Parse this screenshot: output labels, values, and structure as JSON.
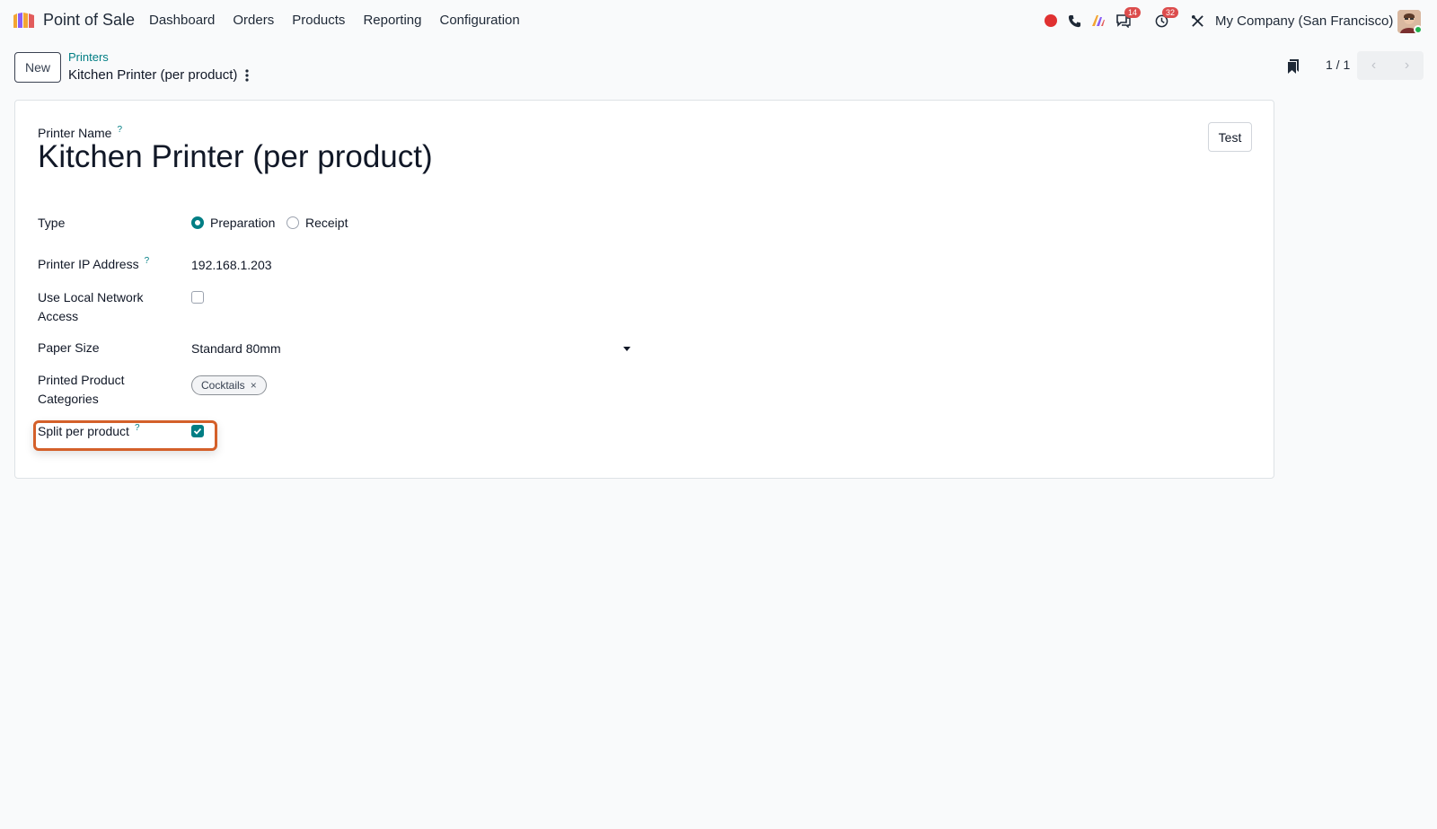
{
  "navbar": {
    "app_title": "Point of Sale",
    "menu": [
      "Dashboard",
      "Orders",
      "Products",
      "Reporting",
      "Configuration"
    ],
    "messages_badge": "14",
    "activities_badge": "32",
    "company": "My Company (San Francisco)"
  },
  "control_panel": {
    "new_label": "New",
    "breadcrumb_parent": "Printers",
    "breadcrumb_current": "Kitchen Printer (per product)",
    "pager": "1 / 1"
  },
  "form": {
    "name_label": "Printer Name",
    "help_mark": "?",
    "name_value": "Kitchen Printer (per product)",
    "test_label": "Test",
    "type_label": "Type",
    "type_options": [
      "Preparation",
      "Receipt"
    ],
    "type_selected": "Preparation",
    "ip_label": "Printer IP Address",
    "ip_value": "192.168.1.203",
    "local_network_label_1": "Use Local Network",
    "local_network_label_2": "Access",
    "local_network_checked": false,
    "paper_size_label": "Paper Size",
    "paper_size_value": "Standard 80mm",
    "categories_label_1": "Printed Product",
    "categories_label_2": "Categories",
    "category_tags": [
      "Cocktails"
    ],
    "tag_remove": "×",
    "split_label": "Split per product",
    "split_checked": true
  },
  "colors": {
    "accent": "#017e84",
    "highlight": "#d4602a",
    "badge": "#dc4c4c"
  }
}
